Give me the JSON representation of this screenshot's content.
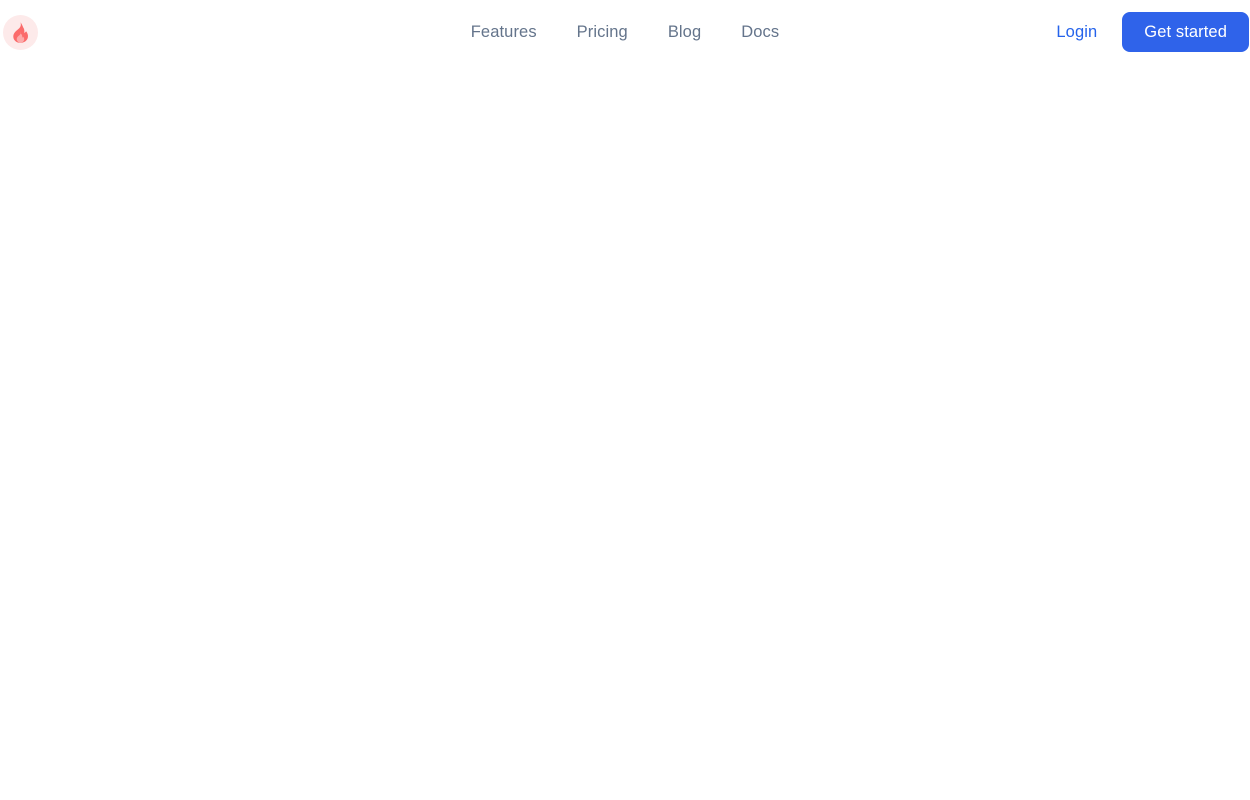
{
  "header": {
    "brand": {
      "icon": "flame-icon",
      "icon_glyph": "🔥",
      "circle_color": "#fdeaea",
      "flame_outer_color": "#fb6b6b",
      "flame_inner_color": "#fca5a5"
    },
    "nav_links": [
      {
        "label": "Features"
      },
      {
        "label": "Pricing"
      },
      {
        "label": "Blog"
      },
      {
        "label": "Docs"
      }
    ],
    "actions": {
      "login_label": "Login",
      "cta_label": "Get started"
    },
    "colors": {
      "nav_text": "#64748b",
      "link_blue": "#2563eb",
      "cta_background": "#2f63ea",
      "cta_text": "#ffffff",
      "background": "#ffffff"
    }
  },
  "body": {
    "content": "",
    "background": "#ffffff"
  }
}
